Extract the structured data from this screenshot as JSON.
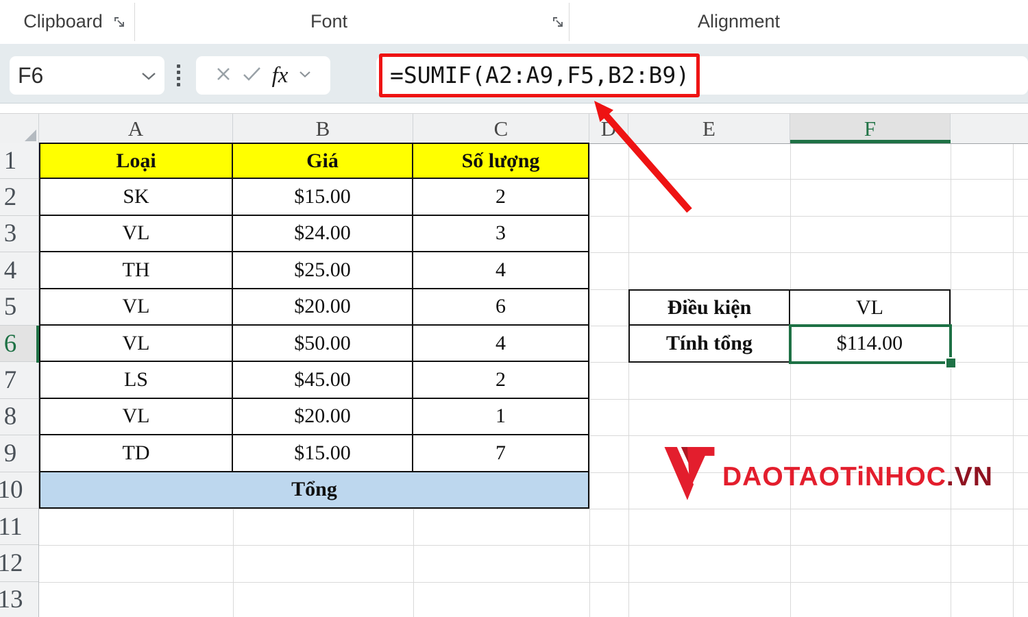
{
  "ribbon": {
    "groups": [
      {
        "label": "Clipboard"
      },
      {
        "label": "Font"
      },
      {
        "label": "Alignment"
      }
    ]
  },
  "formula_bar": {
    "name_box_value": "F6",
    "cancel_icon": "x-icon",
    "enter_icon": "check-icon",
    "fx_label": "fx",
    "formula": "=SUMIF(A2:A9,F5,B2:B9)"
  },
  "grid": {
    "column_headers": [
      "A",
      "B",
      "C",
      "D",
      "E",
      "F"
    ],
    "row_numbers": [
      "1",
      "2",
      "3",
      "4",
      "5",
      "6",
      "7",
      "8",
      "9",
      "10",
      "11",
      "12",
      "13"
    ],
    "selected_column": "F",
    "selected_row": "6",
    "active_cell": "F6"
  },
  "data_table": {
    "headers": [
      "Loại",
      "Giá",
      "Số lượng"
    ],
    "rows": [
      [
        "SK",
        "$15.00",
        "2"
      ],
      [
        "VL",
        "$24.00",
        "3"
      ],
      [
        "TH",
        "$25.00",
        "4"
      ],
      [
        "VL",
        "$20.00",
        "6"
      ],
      [
        "VL",
        "$50.00",
        "4"
      ],
      [
        "LS",
        "$45.00",
        "2"
      ],
      [
        "VL",
        "$20.00",
        "1"
      ],
      [
        "TD",
        "$15.00",
        "7"
      ]
    ],
    "footer": "Tổng"
  },
  "criteria_table": {
    "rows": [
      {
        "label": "Điều kiện",
        "value": "VL"
      },
      {
        "label": "Tính tổng",
        "value": "$114.00"
      }
    ]
  },
  "watermark": {
    "brand": "DAOTAOTiNHOC",
    "domain": ".VN"
  },
  "colors": {
    "header_yellow": "#ffff00",
    "total_blue": "#bdd7ee",
    "excel_green": "#1e7145",
    "annotation_red": "#ee1313",
    "logo_red": "#e31e2d"
  }
}
